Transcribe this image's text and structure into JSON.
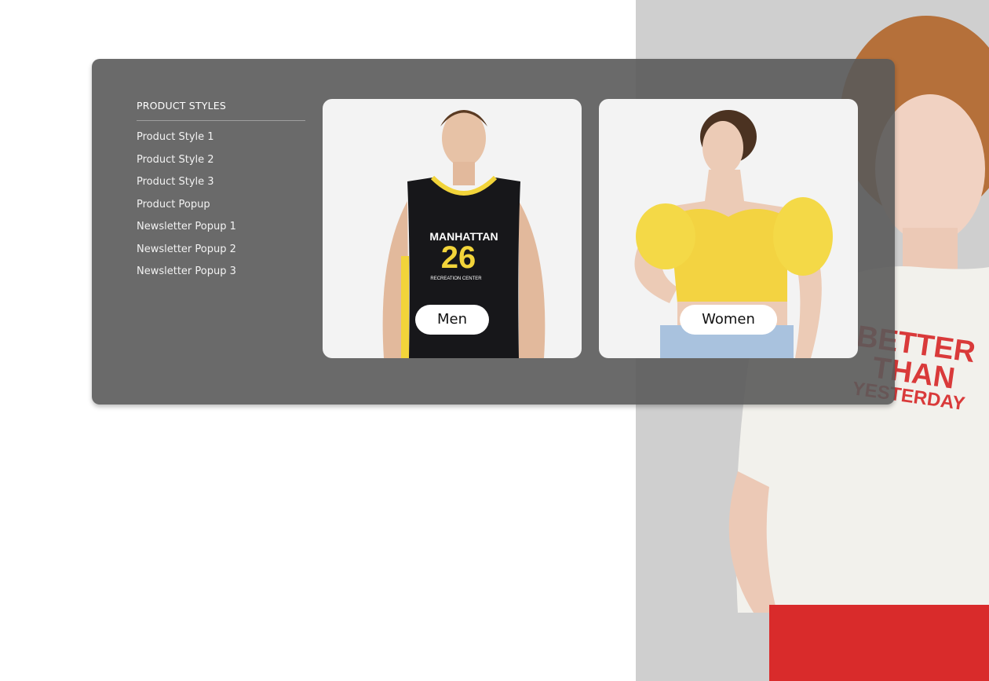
{
  "menu": {
    "heading": "PRODUCT STYLES",
    "items": [
      {
        "label": "Product Style 1"
      },
      {
        "label": "Product Style 2"
      },
      {
        "label": "Product Style 3"
      },
      {
        "label": "Product Popup"
      },
      {
        "label": "Newsletter Popup 1"
      },
      {
        "label": "Newsletter Popup 2"
      },
      {
        "label": "Newsletter Popup 3"
      }
    ]
  },
  "cards": [
    {
      "label": "Men",
      "jersey_text": "MANHATTAN",
      "jersey_number": "26",
      "jersey_sub": "RECREATION CENTER"
    },
    {
      "label": "Women"
    }
  ],
  "hero": {
    "shirt_text": [
      "BETTER",
      "THAN",
      "YESTERDAY"
    ]
  },
  "colors": {
    "panel": "#5a5a5a",
    "accent_yellow": "#f2d43a",
    "hero_red": "#d93a3a"
  }
}
